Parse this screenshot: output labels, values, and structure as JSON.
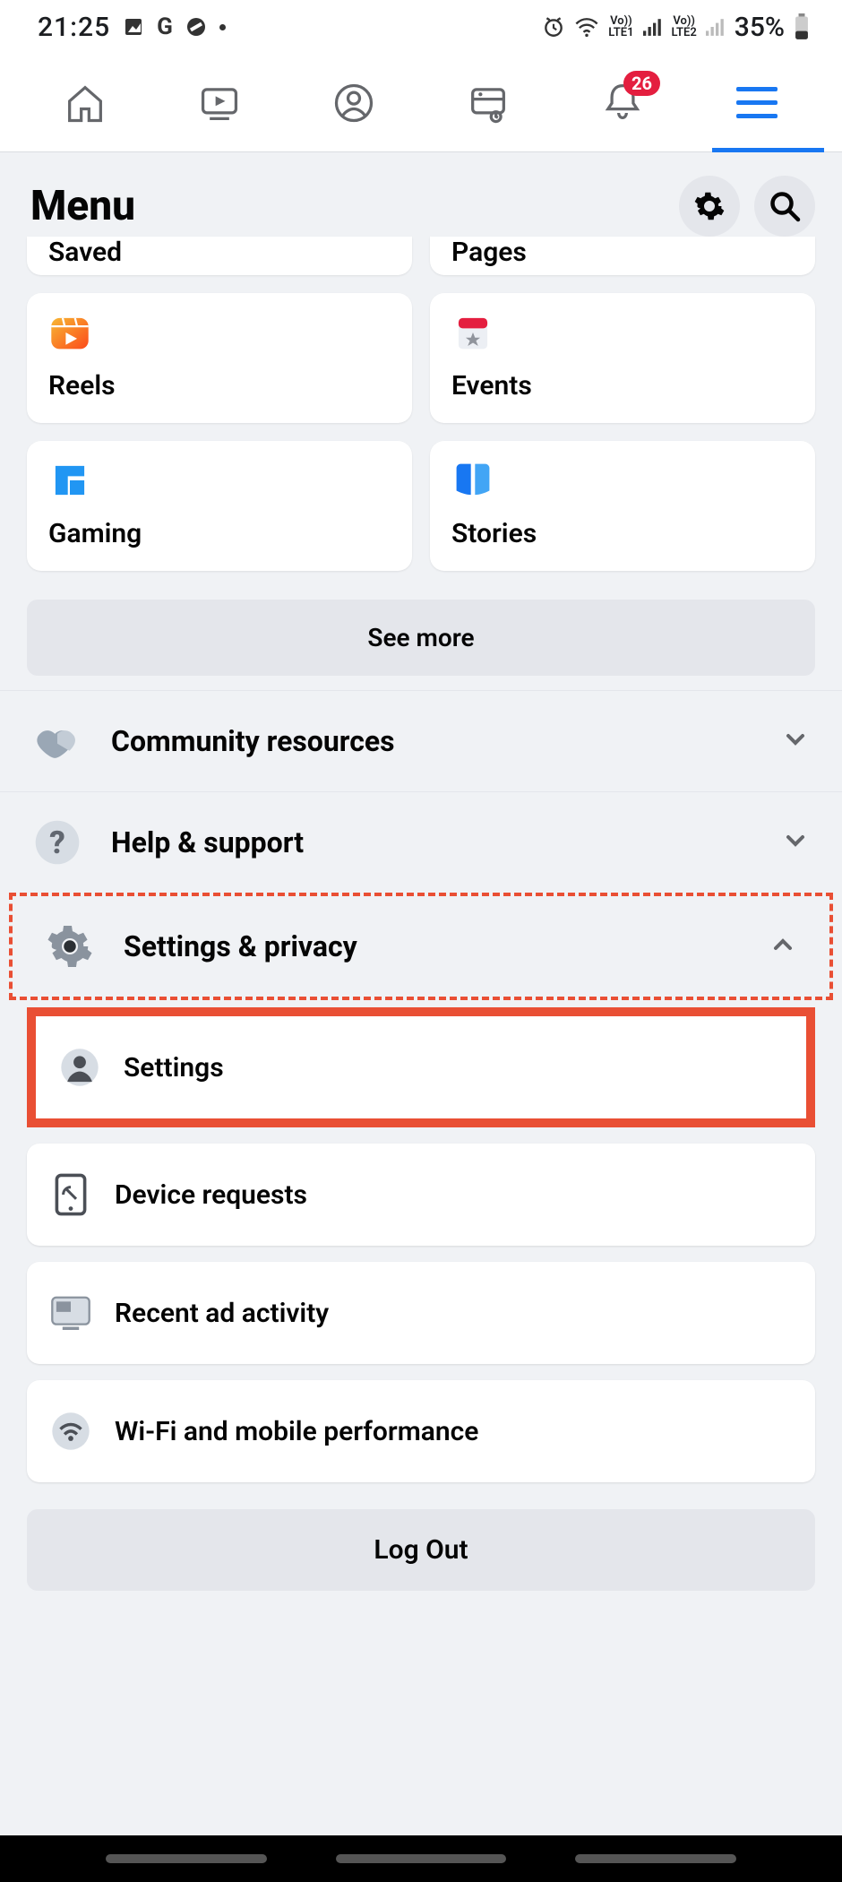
{
  "status": {
    "time": "21:25",
    "battery": "35%",
    "notifBadge": "26",
    "lte1": "Vo))\nLTE1",
    "lte2": "Vo))\nLTE2"
  },
  "header": {
    "title": "Menu"
  },
  "grid": {
    "saved": "Saved",
    "pages": "Pages",
    "reels": "Reels",
    "events": "Events",
    "gaming": "Gaming",
    "stories": "Stories"
  },
  "buttons": {
    "seeMore": "See more",
    "logout": "Log Out"
  },
  "sections": {
    "community": "Community resources",
    "help": "Help & support",
    "settings": "Settings & privacy"
  },
  "subitems": {
    "settings": "Settings",
    "device": "Device requests",
    "recentAd": "Recent ad activity",
    "wifi": "Wi-Fi and mobile performance"
  }
}
